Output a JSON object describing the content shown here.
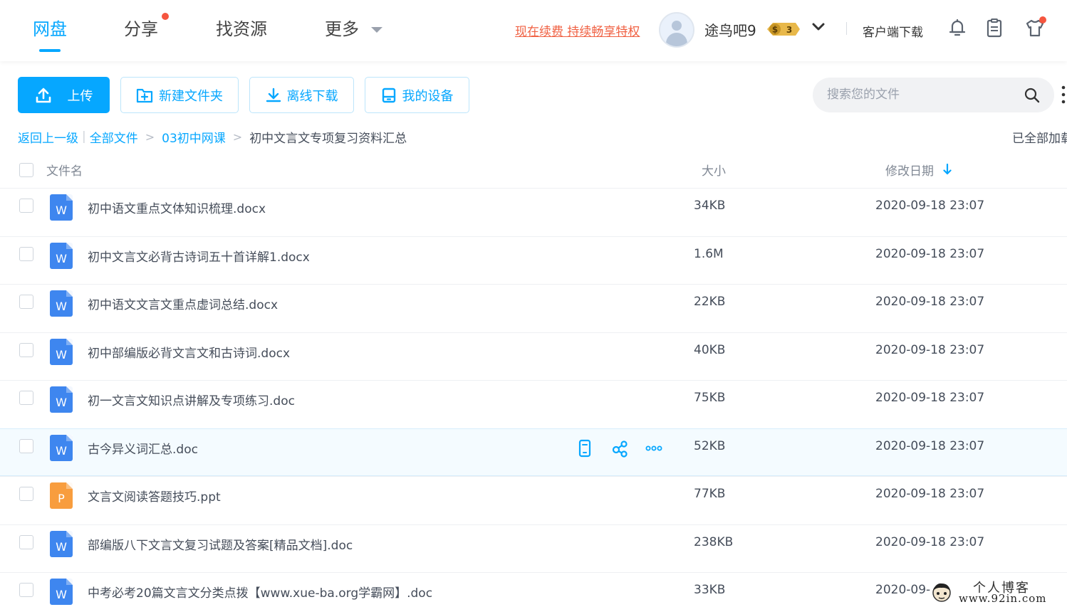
{
  "nav": {
    "tabs": [
      {
        "label": "网盘",
        "active": true
      },
      {
        "label": "分享",
        "active": false,
        "has_dot": true
      },
      {
        "label": "找资源",
        "active": false
      },
      {
        "label": "更多",
        "active": false,
        "has_dropdown": true
      }
    ],
    "promo_link": "现在续费 持续畅享特权",
    "username": "途鸟吧9",
    "vip_level": "3",
    "vip_badge_symbol": "$",
    "client_download": "客户端下载",
    "icons": [
      "bell-icon",
      "clipboard-icon",
      "tshirt-icon"
    ]
  },
  "toolbar": {
    "upload": "上传",
    "new_folder": "新建文件夹",
    "offline_download": "离线下载",
    "my_devices": "我的设备",
    "search_placeholder": "搜索您的文件"
  },
  "breadcrumb": {
    "back": "返回上一级",
    "items": [
      "全部文件",
      "03初中网课"
    ],
    "current": "初中文言文专项复习资料汇总",
    "status": "已全部加载"
  },
  "table": {
    "columns": {
      "name": "文件名",
      "size": "大小",
      "date": "修改日期"
    },
    "sort": "date-desc",
    "rows": [
      {
        "type": "word",
        "type_letter": "W",
        "name": "初中语文重点文体知识梳理.docx",
        "size": "34KB",
        "date": "2020-09-18 23:07"
      },
      {
        "type": "word",
        "type_letter": "W",
        "name": "初中文言文必背古诗词五十首详解1.docx",
        "size": "1.6M",
        "date": "2020-09-18 23:07"
      },
      {
        "type": "word",
        "type_letter": "W",
        "name": "初中语文文言文重点虚词总结.docx",
        "size": "22KB",
        "date": "2020-09-18 23:07"
      },
      {
        "type": "word",
        "type_letter": "W",
        "name": "初中部编版必背文言文和古诗词.docx",
        "size": "40KB",
        "date": "2020-09-18 23:07"
      },
      {
        "type": "word",
        "type_letter": "W",
        "name": "初一文言文知识点讲解及专项练习.doc",
        "size": "75KB",
        "date": "2020-09-18 23:07"
      },
      {
        "type": "word",
        "type_letter": "W",
        "name": "古今异义词汇总.doc",
        "size": "52KB",
        "date": "2020-09-18 23:07",
        "hovered": true
      },
      {
        "type": "ppt",
        "type_letter": "P",
        "name": "文言文阅读答题技巧.ppt",
        "size": "77KB",
        "date": "2020-09-18 23:07"
      },
      {
        "type": "word",
        "type_letter": "W",
        "name": "部编版八下文言文复习试题及答案[精品文档].doc",
        "size": "238KB",
        "date": "2020-09-18 23:07"
      },
      {
        "type": "word",
        "type_letter": "W",
        "name": "中考必考20篇文言文分类点拨【www.xue-ba.org学霸网】.doc",
        "size": "33KB",
        "date": "2020-09-"
      }
    ],
    "row_actions": [
      "send-to-phone-icon",
      "share-icon",
      "more-dots-icon"
    ]
  },
  "watermark": {
    "title": "个人博客",
    "url": "www.92in.com"
  },
  "colors": {
    "accent": "#06a7ff",
    "promo": "#f06143",
    "word": "#3e86ef",
    "ppt": "#f89d3e",
    "hover_row": "#f4fbff"
  }
}
